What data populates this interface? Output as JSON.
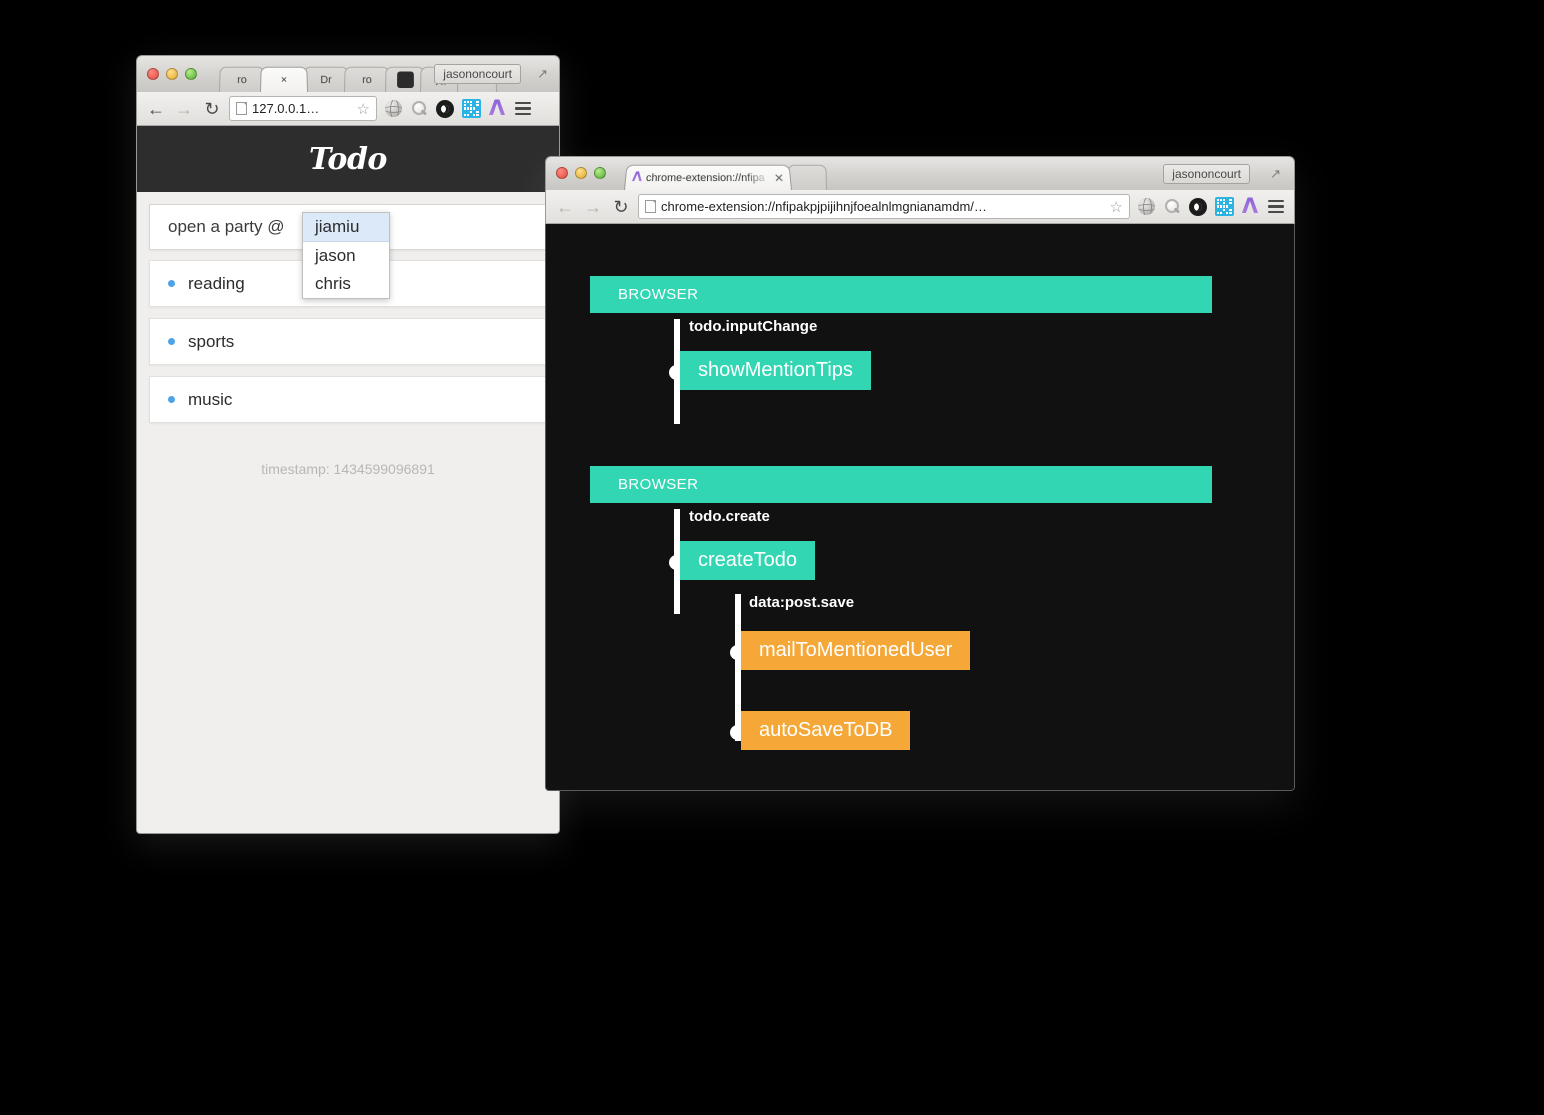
{
  "windows": {
    "todo_app": {
      "user_label": "jasononcourt",
      "tabs": [
        {
          "label": "ro"
        },
        {
          "label": "×"
        },
        {
          "label": "Dr"
        },
        {
          "label": "ro"
        },
        {
          "label": ""
        },
        {
          "label": "知"
        },
        {
          "label": ""
        }
      ],
      "omnibox": {
        "url": "127.0.0.1…"
      },
      "extension_icons": [
        "globe-icon",
        "search-icon",
        "circle-c-icon",
        "qr-code-icon",
        "lambda-logo-icon",
        "hamburger-menu-icon"
      ],
      "page": {
        "logo": "Todo",
        "input_value": "open a party @",
        "mention_suggestions": [
          "jiamiu",
          "jason",
          "chris"
        ],
        "selected_suggestion": "jiamiu",
        "items": [
          {
            "label": "reading"
          },
          {
            "label": "sports"
          },
          {
            "label": "music"
          }
        ],
        "timestamp": "timestamp: 1434599096891"
      }
    },
    "extension_devtool": {
      "user_label": "jasononcourt",
      "tab_title": "chrome-extension://nfipa",
      "omnibox": {
        "url": "chrome-extension://nfipakpjpijihnjfoealnlmgnianamdm/…"
      },
      "extension_icons": [
        "globe-icon",
        "search-icon",
        "circle-c-icon",
        "qr-code-icon",
        "lambda-logo-icon",
        "hamburger-menu-icon"
      ],
      "flows": [
        {
          "source": "BROWSER",
          "event": "todo.inputChange",
          "nodes": [
            {
              "label": "showMentionTips",
              "kind": "green"
            }
          ]
        },
        {
          "source": "BROWSER",
          "event": "todo.create",
          "nodes": [
            {
              "label": "createTodo",
              "kind": "green"
            }
          ],
          "sub_event": "data:post.save",
          "sub_nodes": [
            {
              "label": "mailToMentionedUser",
              "kind": "orange"
            },
            {
              "label": "autoSaveToDB",
              "kind": "orange"
            }
          ]
        }
      ]
    }
  },
  "colors": {
    "accent_green": "#33d6b2",
    "accent_orange": "#f5a838",
    "panel_bg": "#111111",
    "todo_header_bg": "#2e2d2d",
    "bullet_blue": "#4da3e8",
    "mention_highlight": "#dce9f8"
  }
}
